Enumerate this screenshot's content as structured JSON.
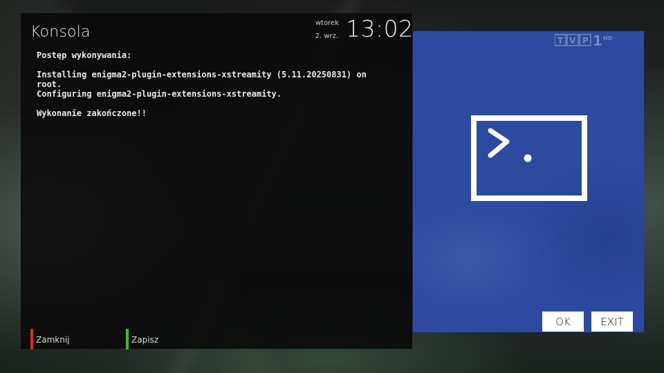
{
  "window": {
    "title": "Konsola"
  },
  "clock": {
    "day": "wtorek",
    "date": "2. wrz.",
    "time": "13:02"
  },
  "console": {
    "lines": [
      "Postęp wykonywania:",
      "",
      "Installing enigma2-plugin-extensions-xstreamity (5.11.20250831) on",
      "root.",
      "Configuring enigma2-plugin-extensions-xstreamity.",
      "",
      "Wykonanie zakończone!!"
    ]
  },
  "keys": {
    "red": {
      "label": "Zamknij",
      "color": "#e02b20"
    },
    "green": {
      "label": "Zapisz",
      "color": "#35c02a"
    }
  },
  "preview": {
    "background": "#2b4aa0",
    "channel_logo": "TVP 1 HD",
    "icon": "terminal-icon"
  },
  "buttons": {
    "ok_label": "OK",
    "exit_label": "EXIT"
  }
}
